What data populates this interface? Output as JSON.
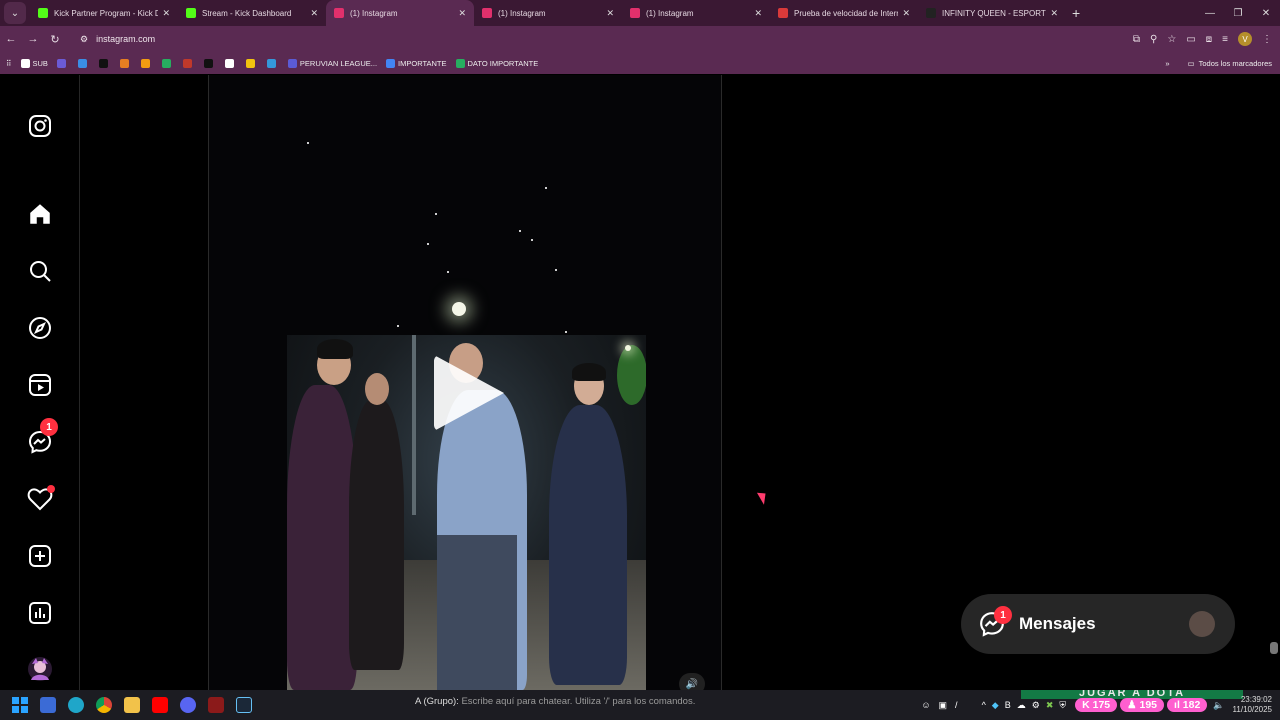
{
  "browser": {
    "tabs": [
      {
        "title": "Kick Partner Program - Kick Da",
        "color": "#53fc18",
        "active": false
      },
      {
        "title": "Stream - Kick Dashboard",
        "color": "#53fc18",
        "active": false
      },
      {
        "title": "(1) Instagram",
        "color": "#e1306c",
        "active": true
      },
      {
        "title": "(1) Instagram",
        "color": "#e1306c",
        "active": false
      },
      {
        "title": "(1) Instagram",
        "color": "#e1306c",
        "active": false
      },
      {
        "title": "Prueba de velocidad de Interne",
        "color": "#d93a3a",
        "active": false
      },
      {
        "title": "INFINITY QUEEN - ESPORTS FE",
        "color": "#222222",
        "active": false
      }
    ],
    "url": "instagram.com",
    "bookmarks": [
      {
        "label": "SUB",
        "color": "#ffffff"
      },
      {
        "label": "",
        "color": "#6b5bd6"
      },
      {
        "label": "",
        "color": "#3a8ee6"
      },
      {
        "label": "",
        "color": "#111111"
      },
      {
        "label": "",
        "color": "#e67e22"
      },
      {
        "label": "",
        "color": "#f39c12"
      },
      {
        "label": "",
        "color": "#27ae60"
      },
      {
        "label": "",
        "color": "#c0392b"
      },
      {
        "label": "",
        "color": "#111111"
      },
      {
        "label": "",
        "color": "#ffffff"
      },
      {
        "label": "",
        "color": "#f1c40f"
      },
      {
        "label": "",
        "color": "#3498db"
      },
      {
        "label": "PERUVIAN LEAGUE...",
        "color": "#5b5bd6"
      },
      {
        "label": "IMPORTANTE",
        "color": "#4285f4"
      },
      {
        "label": "DATO IMPORTANTE",
        "color": "#27ae60"
      }
    ],
    "all_bookmarks": "Todos los marcadores"
  },
  "instagram": {
    "nav": [
      {
        "name": "instagram-logo-icon"
      },
      {
        "name": "home-icon"
      },
      {
        "name": "search-icon"
      },
      {
        "name": "explore-icon"
      },
      {
        "name": "reels-icon"
      },
      {
        "name": "messenger-icon",
        "badge": "1"
      },
      {
        "name": "notifications-icon"
      },
      {
        "name": "create-icon"
      },
      {
        "name": "dashboard-icon"
      },
      {
        "name": "profile-avatar"
      }
    ],
    "messages": {
      "label": "Mensajes",
      "badge": "1"
    }
  },
  "taskbar": {
    "chat_prefix": "A (Grupo):",
    "chat_hint": "Escribe aquí para chatear. Utiliza '/' para los comandos.",
    "banner": "JUGAR A DOTA",
    "stats": [
      {
        "value": "175",
        "icon": "kick-icon"
      },
      {
        "value": "195",
        "icon": "user-icon"
      },
      {
        "value": "182",
        "icon": "bars-icon"
      }
    ],
    "time": "23:39:02",
    "date": "11/10/2025"
  }
}
